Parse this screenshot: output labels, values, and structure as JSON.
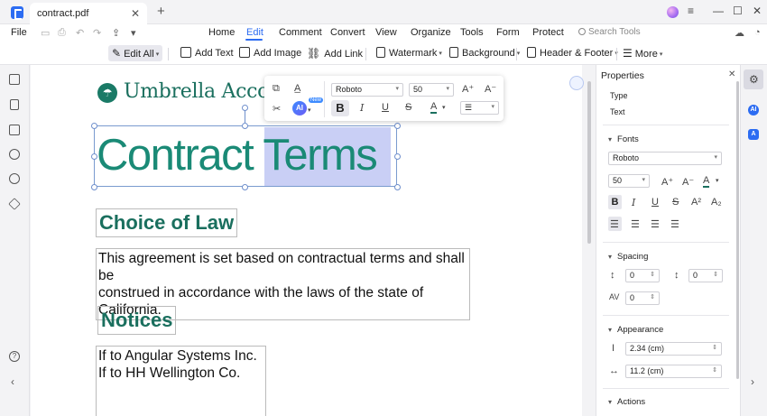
{
  "window": {
    "tab_title": "contract.pdf"
  },
  "menu": {
    "file": "File",
    "items": [
      "Home",
      "Edit",
      "Comment",
      "Convert",
      "View",
      "Organize",
      "Tools",
      "Form",
      "Protect"
    ],
    "active": "Edit",
    "search_placeholder": "Search Tools"
  },
  "toolbar": {
    "edit_all": "Edit All",
    "add_text": "Add Text",
    "add_image": "Add Image",
    "add_link": "Add Link",
    "watermark": "Watermark",
    "background": "Background",
    "header_footer": "Header & Footer",
    "more": "More"
  },
  "document": {
    "brand": "Umbrella Accou",
    "title_part1": "Contract ",
    "title_part2": "Terms",
    "section1": "Choice of Law",
    "para1_line1": "This agreement is set based on contractual terms and shall be",
    "para1_line2": "construed in accordance with the laws of the state of California.",
    "section2": "Notices",
    "para2_line1": "If to Angular Systems Inc.",
    "para2_line2": "If to HH Wellington Co."
  },
  "format_bar": {
    "font": "Roboto",
    "size": "50",
    "ai_label": "AI",
    "new_badge": "New"
  },
  "properties": {
    "title": "Properties",
    "type_label": "Type",
    "type_value": "Text",
    "fonts_label": "Fonts",
    "font_value": "Roboto",
    "size_value": "50",
    "spacing_label": "Spacing",
    "line_spacing": "0",
    "para_spacing": "0",
    "char_spacing": "0",
    "appearance_label": "Appearance",
    "height_value": "2.34 (cm)",
    "width_value": "11.2 (cm)",
    "actions_label": "Actions"
  },
  "colors": {
    "accent": "#2c6cf2",
    "heading_green": "#1a6f5e",
    "title_green": "#1a8a76",
    "selection": "#c9cff5"
  }
}
